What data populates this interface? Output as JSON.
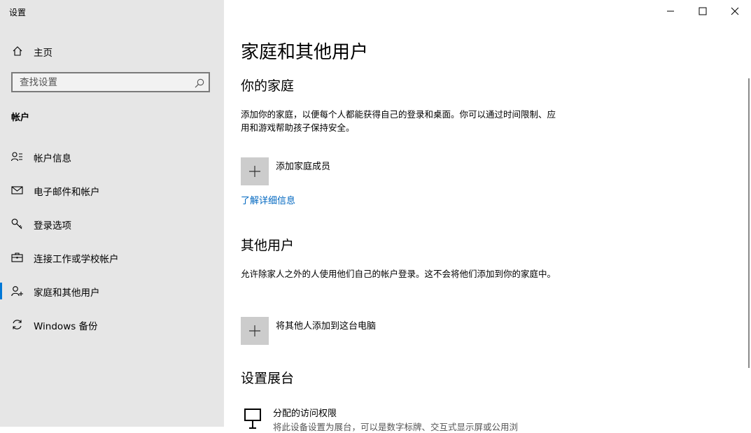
{
  "window": {
    "title": "设置",
    "controls": [
      "minimize",
      "maximize",
      "close"
    ]
  },
  "sidebar": {
    "home_label": "主页",
    "search_placeholder": "查找设置",
    "section_label": "帐户",
    "items": [
      {
        "label": "帐户信息",
        "icon": "person-info-icon"
      },
      {
        "label": "电子邮件和帐户",
        "icon": "mail-icon"
      },
      {
        "label": "登录选项",
        "icon": "key-icon"
      },
      {
        "label": "连接工作或学校帐户",
        "icon": "briefcase-icon"
      },
      {
        "label": "家庭和其他用户",
        "icon": "person-add-icon",
        "active": true
      },
      {
        "label": "Windows 备份",
        "icon": "sync-icon"
      }
    ],
    "accent_color": "#0078d7"
  },
  "main": {
    "title": "家庭和其他用户",
    "family": {
      "heading": "你的家庭",
      "description": "添加你的家庭，以便每个人都能获得自己的登录和桌面。你可以通过时间限制、应用和游戏帮助孩子保持安全。",
      "add_label": "添加家庭成员",
      "learn_more": "了解详细信息"
    },
    "others": {
      "heading": "其他用户",
      "description": "允许除家人之外的人使用他们自己的帐户登录。这不会将他们添加到你的家庭中。",
      "add_label": "将其他人添加到这台电脑"
    },
    "kiosk": {
      "heading": "设置展台",
      "item_label": "分配的访问权限",
      "item_sub": "将此设备设置为展台，可以是数字标牌、交互式显示屏或公用浏"
    }
  }
}
